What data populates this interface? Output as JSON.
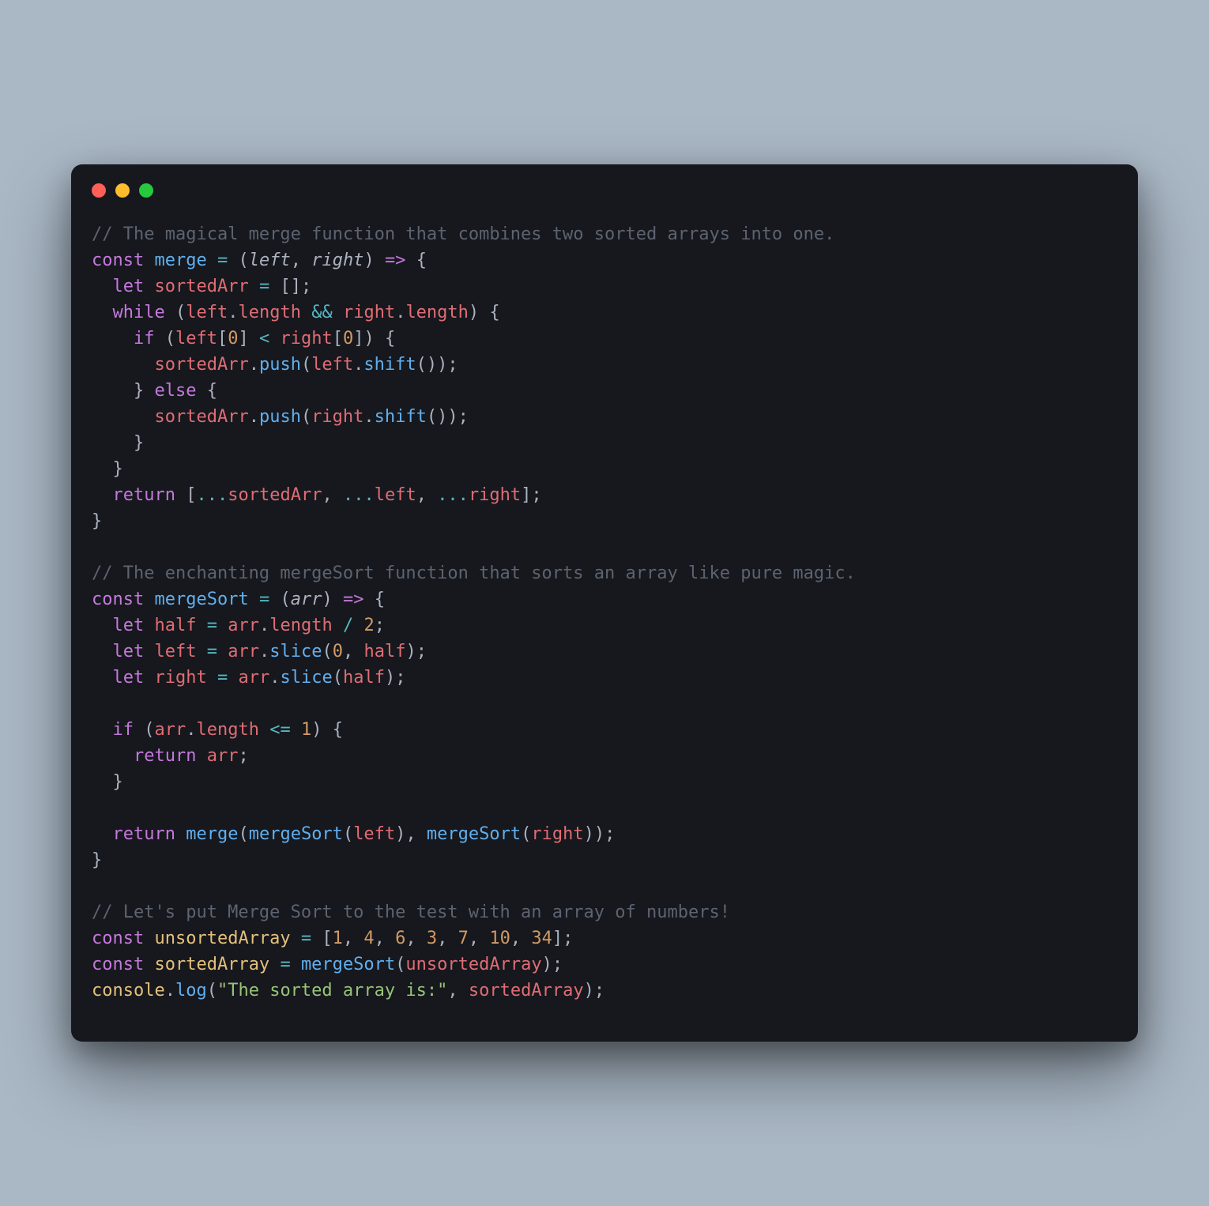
{
  "window": {
    "traffic_lights": [
      "close",
      "minimize",
      "maximize"
    ]
  },
  "code": {
    "tokens": [
      {
        "t": "// The magical merge function that combines two sorted arrays into one.",
        "c": "c-comment"
      },
      {
        "t": "\n"
      },
      {
        "t": "const",
        "c": "c-kw"
      },
      {
        "t": " "
      },
      {
        "t": "merge",
        "c": "c-fn"
      },
      {
        "t": " "
      },
      {
        "t": "=",
        "c": "c-op"
      },
      {
        "t": " "
      },
      {
        "t": "(",
        "c": "c-punc"
      },
      {
        "t": "left",
        "c": "c-param"
      },
      {
        "t": ",",
        "c": "c-punc"
      },
      {
        "t": " "
      },
      {
        "t": "right",
        "c": "c-param"
      },
      {
        "t": ")",
        "c": "c-punc"
      },
      {
        "t": " "
      },
      {
        "t": "=>",
        "c": "c-kw"
      },
      {
        "t": " "
      },
      {
        "t": "{",
        "c": "c-punc"
      },
      {
        "t": "\n"
      },
      {
        "t": "  "
      },
      {
        "t": "let",
        "c": "c-kw"
      },
      {
        "t": " "
      },
      {
        "t": "sortedArr",
        "c": "c-ident"
      },
      {
        "t": " "
      },
      {
        "t": "=",
        "c": "c-op"
      },
      {
        "t": " "
      },
      {
        "t": "[",
        "c": "c-punc"
      },
      {
        "t": "]",
        "c": "c-punc"
      },
      {
        "t": ";",
        "c": "c-punc"
      },
      {
        "t": "\n"
      },
      {
        "t": "  "
      },
      {
        "t": "while",
        "c": "c-kw"
      },
      {
        "t": " "
      },
      {
        "t": "(",
        "c": "c-punc"
      },
      {
        "t": "left",
        "c": "c-ident"
      },
      {
        "t": ".",
        "c": "c-punc"
      },
      {
        "t": "length",
        "c": "c-prop"
      },
      {
        "t": " "
      },
      {
        "t": "&&",
        "c": "c-op"
      },
      {
        "t": " "
      },
      {
        "t": "right",
        "c": "c-ident"
      },
      {
        "t": ".",
        "c": "c-punc"
      },
      {
        "t": "length",
        "c": "c-prop"
      },
      {
        "t": ")",
        "c": "c-punc"
      },
      {
        "t": " "
      },
      {
        "t": "{",
        "c": "c-punc"
      },
      {
        "t": "\n"
      },
      {
        "t": "    "
      },
      {
        "t": "if",
        "c": "c-kw"
      },
      {
        "t": " "
      },
      {
        "t": "(",
        "c": "c-punc"
      },
      {
        "t": "left",
        "c": "c-ident"
      },
      {
        "t": "[",
        "c": "c-punc"
      },
      {
        "t": "0",
        "c": "c-num"
      },
      {
        "t": "]",
        "c": "c-punc"
      },
      {
        "t": " "
      },
      {
        "t": "<",
        "c": "c-op"
      },
      {
        "t": " "
      },
      {
        "t": "right",
        "c": "c-ident"
      },
      {
        "t": "[",
        "c": "c-punc"
      },
      {
        "t": "0",
        "c": "c-num"
      },
      {
        "t": "]",
        "c": "c-punc"
      },
      {
        "t": ")",
        "c": "c-punc"
      },
      {
        "t": " "
      },
      {
        "t": "{",
        "c": "c-punc"
      },
      {
        "t": "\n"
      },
      {
        "t": "      "
      },
      {
        "t": "sortedArr",
        "c": "c-ident"
      },
      {
        "t": ".",
        "c": "c-punc"
      },
      {
        "t": "push",
        "c": "c-fn"
      },
      {
        "t": "(",
        "c": "c-punc"
      },
      {
        "t": "left",
        "c": "c-ident"
      },
      {
        "t": ".",
        "c": "c-punc"
      },
      {
        "t": "shift",
        "c": "c-fn"
      },
      {
        "t": "(",
        "c": "c-punc"
      },
      {
        "t": ")",
        "c": "c-punc"
      },
      {
        "t": ")",
        "c": "c-punc"
      },
      {
        "t": ";",
        "c": "c-punc"
      },
      {
        "t": "\n"
      },
      {
        "t": "    "
      },
      {
        "t": "}",
        "c": "c-punc"
      },
      {
        "t": " "
      },
      {
        "t": "else",
        "c": "c-kw"
      },
      {
        "t": " "
      },
      {
        "t": "{",
        "c": "c-punc"
      },
      {
        "t": "\n"
      },
      {
        "t": "      "
      },
      {
        "t": "sortedArr",
        "c": "c-ident"
      },
      {
        "t": ".",
        "c": "c-punc"
      },
      {
        "t": "push",
        "c": "c-fn"
      },
      {
        "t": "(",
        "c": "c-punc"
      },
      {
        "t": "right",
        "c": "c-ident"
      },
      {
        "t": ".",
        "c": "c-punc"
      },
      {
        "t": "shift",
        "c": "c-fn"
      },
      {
        "t": "(",
        "c": "c-punc"
      },
      {
        "t": ")",
        "c": "c-punc"
      },
      {
        "t": ")",
        "c": "c-punc"
      },
      {
        "t": ";",
        "c": "c-punc"
      },
      {
        "t": "\n"
      },
      {
        "t": "    "
      },
      {
        "t": "}",
        "c": "c-punc"
      },
      {
        "t": "\n"
      },
      {
        "t": "  "
      },
      {
        "t": "}",
        "c": "c-punc"
      },
      {
        "t": "\n"
      },
      {
        "t": "  "
      },
      {
        "t": "return",
        "c": "c-kw"
      },
      {
        "t": " "
      },
      {
        "t": "[",
        "c": "c-punc"
      },
      {
        "t": "...",
        "c": "c-op"
      },
      {
        "t": "sortedArr",
        "c": "c-ident"
      },
      {
        "t": ",",
        "c": "c-punc"
      },
      {
        "t": " "
      },
      {
        "t": "...",
        "c": "c-op"
      },
      {
        "t": "left",
        "c": "c-ident"
      },
      {
        "t": ",",
        "c": "c-punc"
      },
      {
        "t": " "
      },
      {
        "t": "...",
        "c": "c-op"
      },
      {
        "t": "right",
        "c": "c-ident"
      },
      {
        "t": "]",
        "c": "c-punc"
      },
      {
        "t": ";",
        "c": "c-punc"
      },
      {
        "t": "\n"
      },
      {
        "t": "}",
        "c": "c-punc"
      },
      {
        "t": "\n"
      },
      {
        "t": "\n"
      },
      {
        "t": "// The enchanting mergeSort function that sorts an array like pure magic.",
        "c": "c-comment"
      },
      {
        "t": "\n"
      },
      {
        "t": "const",
        "c": "c-kw"
      },
      {
        "t": " "
      },
      {
        "t": "mergeSort",
        "c": "c-fn"
      },
      {
        "t": " "
      },
      {
        "t": "=",
        "c": "c-op"
      },
      {
        "t": " "
      },
      {
        "t": "(",
        "c": "c-punc"
      },
      {
        "t": "arr",
        "c": "c-param"
      },
      {
        "t": ")",
        "c": "c-punc"
      },
      {
        "t": " "
      },
      {
        "t": "=>",
        "c": "c-kw"
      },
      {
        "t": " "
      },
      {
        "t": "{",
        "c": "c-punc"
      },
      {
        "t": "\n"
      },
      {
        "t": "  "
      },
      {
        "t": "let",
        "c": "c-kw"
      },
      {
        "t": " "
      },
      {
        "t": "half",
        "c": "c-ident"
      },
      {
        "t": " "
      },
      {
        "t": "=",
        "c": "c-op"
      },
      {
        "t": " "
      },
      {
        "t": "arr",
        "c": "c-ident"
      },
      {
        "t": ".",
        "c": "c-punc"
      },
      {
        "t": "length",
        "c": "c-prop"
      },
      {
        "t": " "
      },
      {
        "t": "/",
        "c": "c-op"
      },
      {
        "t": " "
      },
      {
        "t": "2",
        "c": "c-num"
      },
      {
        "t": ";",
        "c": "c-punc"
      },
      {
        "t": "\n"
      },
      {
        "t": "  "
      },
      {
        "t": "let",
        "c": "c-kw"
      },
      {
        "t": " "
      },
      {
        "t": "left",
        "c": "c-ident"
      },
      {
        "t": " "
      },
      {
        "t": "=",
        "c": "c-op"
      },
      {
        "t": " "
      },
      {
        "t": "arr",
        "c": "c-ident"
      },
      {
        "t": ".",
        "c": "c-punc"
      },
      {
        "t": "slice",
        "c": "c-fn"
      },
      {
        "t": "(",
        "c": "c-punc"
      },
      {
        "t": "0",
        "c": "c-num"
      },
      {
        "t": ",",
        "c": "c-punc"
      },
      {
        "t": " "
      },
      {
        "t": "half",
        "c": "c-ident"
      },
      {
        "t": ")",
        "c": "c-punc"
      },
      {
        "t": ";",
        "c": "c-punc"
      },
      {
        "t": "\n"
      },
      {
        "t": "  "
      },
      {
        "t": "let",
        "c": "c-kw"
      },
      {
        "t": " "
      },
      {
        "t": "right",
        "c": "c-ident"
      },
      {
        "t": " "
      },
      {
        "t": "=",
        "c": "c-op"
      },
      {
        "t": " "
      },
      {
        "t": "arr",
        "c": "c-ident"
      },
      {
        "t": ".",
        "c": "c-punc"
      },
      {
        "t": "slice",
        "c": "c-fn"
      },
      {
        "t": "(",
        "c": "c-punc"
      },
      {
        "t": "half",
        "c": "c-ident"
      },
      {
        "t": ")",
        "c": "c-punc"
      },
      {
        "t": ";",
        "c": "c-punc"
      },
      {
        "t": "\n"
      },
      {
        "t": "\n"
      },
      {
        "t": "  "
      },
      {
        "t": "if",
        "c": "c-kw"
      },
      {
        "t": " "
      },
      {
        "t": "(",
        "c": "c-punc"
      },
      {
        "t": "arr",
        "c": "c-ident"
      },
      {
        "t": ".",
        "c": "c-punc"
      },
      {
        "t": "length",
        "c": "c-prop"
      },
      {
        "t": " "
      },
      {
        "t": "<=",
        "c": "c-op"
      },
      {
        "t": " "
      },
      {
        "t": "1",
        "c": "c-num"
      },
      {
        "t": ")",
        "c": "c-punc"
      },
      {
        "t": " "
      },
      {
        "t": "{",
        "c": "c-punc"
      },
      {
        "t": "\n"
      },
      {
        "t": "    "
      },
      {
        "t": "return",
        "c": "c-kw"
      },
      {
        "t": " "
      },
      {
        "t": "arr",
        "c": "c-ident"
      },
      {
        "t": ";",
        "c": "c-punc"
      },
      {
        "t": "\n"
      },
      {
        "t": "  "
      },
      {
        "t": "}",
        "c": "c-punc"
      },
      {
        "t": "\n"
      },
      {
        "t": "\n"
      },
      {
        "t": "  "
      },
      {
        "t": "return",
        "c": "c-kw"
      },
      {
        "t": " "
      },
      {
        "t": "merge",
        "c": "c-fn"
      },
      {
        "t": "(",
        "c": "c-punc"
      },
      {
        "t": "mergeSort",
        "c": "c-fn"
      },
      {
        "t": "(",
        "c": "c-punc"
      },
      {
        "t": "left",
        "c": "c-ident"
      },
      {
        "t": ")",
        "c": "c-punc"
      },
      {
        "t": ",",
        "c": "c-punc"
      },
      {
        "t": " "
      },
      {
        "t": "mergeSort",
        "c": "c-fn"
      },
      {
        "t": "(",
        "c": "c-punc"
      },
      {
        "t": "right",
        "c": "c-ident"
      },
      {
        "t": ")",
        "c": "c-punc"
      },
      {
        "t": ")",
        "c": "c-punc"
      },
      {
        "t": ";",
        "c": "c-punc"
      },
      {
        "t": "\n"
      },
      {
        "t": "}",
        "c": "c-punc"
      },
      {
        "t": "\n"
      },
      {
        "t": "\n"
      },
      {
        "t": "// Let's put Merge Sort to the test with an array of numbers!",
        "c": "c-comment"
      },
      {
        "t": "\n"
      },
      {
        "t": "const",
        "c": "c-kw"
      },
      {
        "t": " "
      },
      {
        "t": "unsortedArray",
        "c": "c-decl"
      },
      {
        "t": " "
      },
      {
        "t": "=",
        "c": "c-op"
      },
      {
        "t": " "
      },
      {
        "t": "[",
        "c": "c-punc"
      },
      {
        "t": "1",
        "c": "c-num"
      },
      {
        "t": ",",
        "c": "c-punc"
      },
      {
        "t": " "
      },
      {
        "t": "4",
        "c": "c-num"
      },
      {
        "t": ",",
        "c": "c-punc"
      },
      {
        "t": " "
      },
      {
        "t": "6",
        "c": "c-num"
      },
      {
        "t": ",",
        "c": "c-punc"
      },
      {
        "t": " "
      },
      {
        "t": "3",
        "c": "c-num"
      },
      {
        "t": ",",
        "c": "c-punc"
      },
      {
        "t": " "
      },
      {
        "t": "7",
        "c": "c-num"
      },
      {
        "t": ",",
        "c": "c-punc"
      },
      {
        "t": " "
      },
      {
        "t": "10",
        "c": "c-num"
      },
      {
        "t": ",",
        "c": "c-punc"
      },
      {
        "t": " "
      },
      {
        "t": "34",
        "c": "c-num"
      },
      {
        "t": "]",
        "c": "c-punc"
      },
      {
        "t": ";",
        "c": "c-punc"
      },
      {
        "t": "\n"
      },
      {
        "t": "const",
        "c": "c-kw"
      },
      {
        "t": " "
      },
      {
        "t": "sortedArray",
        "c": "c-decl"
      },
      {
        "t": " "
      },
      {
        "t": "=",
        "c": "c-op"
      },
      {
        "t": " "
      },
      {
        "t": "mergeSort",
        "c": "c-fn"
      },
      {
        "t": "(",
        "c": "c-punc"
      },
      {
        "t": "unsortedArray",
        "c": "c-ident"
      },
      {
        "t": ")",
        "c": "c-punc"
      },
      {
        "t": ";",
        "c": "c-punc"
      },
      {
        "t": "\n"
      },
      {
        "t": "console",
        "c": "c-decl"
      },
      {
        "t": ".",
        "c": "c-punc"
      },
      {
        "t": "log",
        "c": "c-fn"
      },
      {
        "t": "(",
        "c": "c-punc"
      },
      {
        "t": "\"The sorted array is:\"",
        "c": "c-str"
      },
      {
        "t": ",",
        "c": "c-punc"
      },
      {
        "t": " "
      },
      {
        "t": "sortedArray",
        "c": "c-ident"
      },
      {
        "t": ")",
        "c": "c-punc"
      },
      {
        "t": ";",
        "c": "c-punc"
      }
    ]
  }
}
